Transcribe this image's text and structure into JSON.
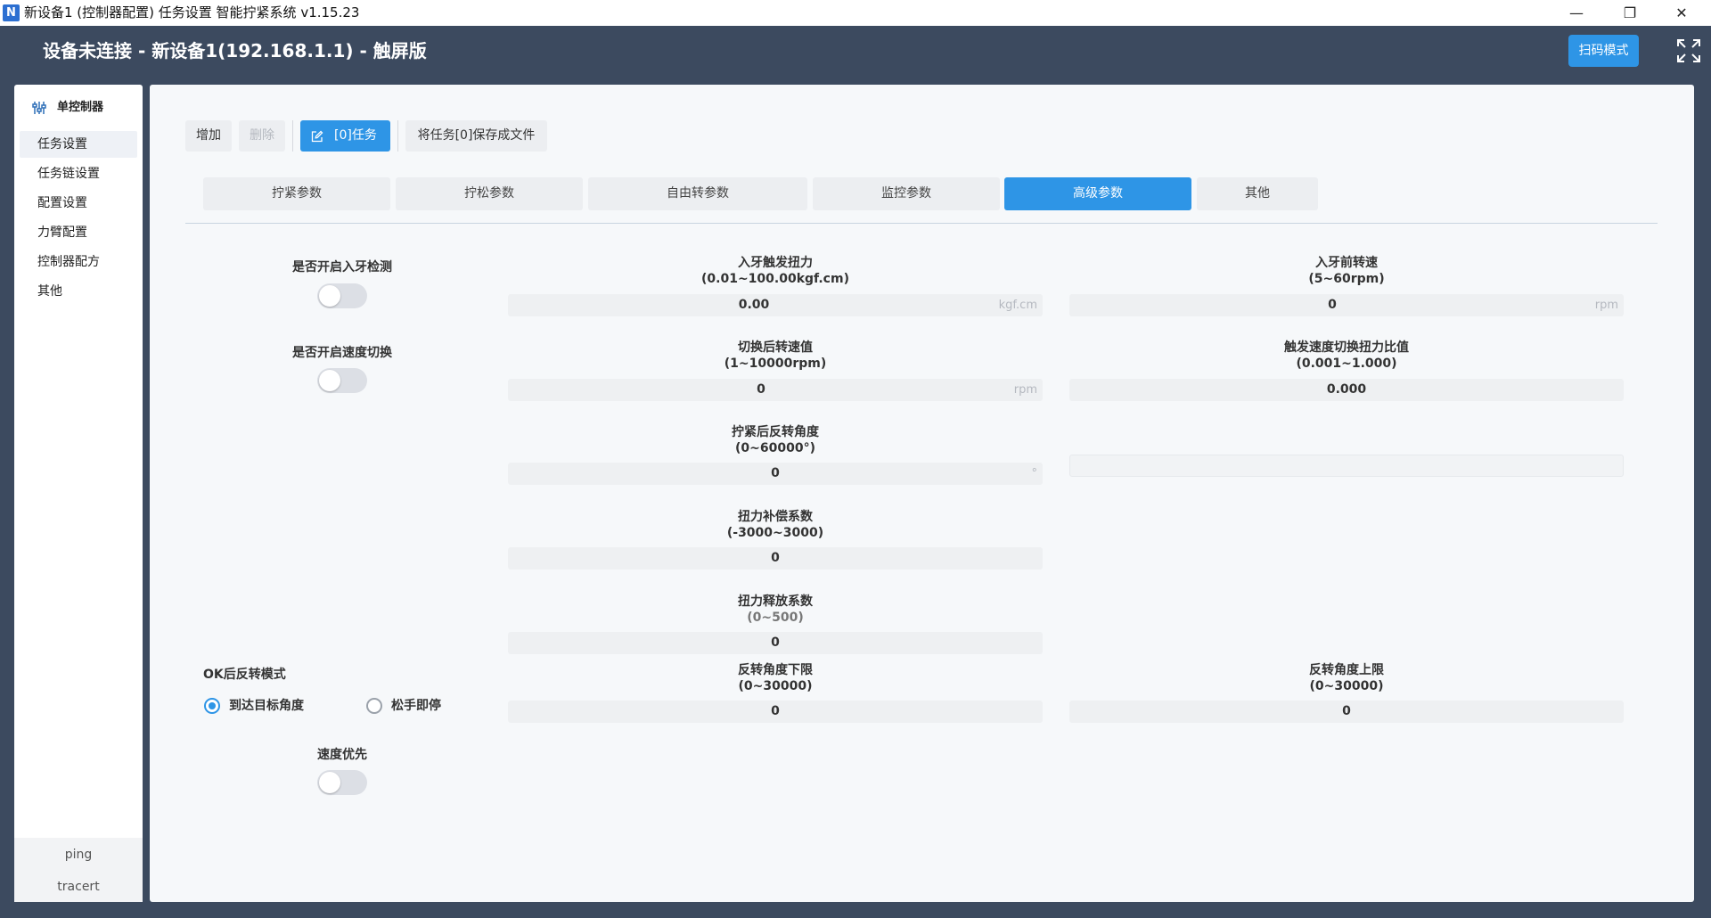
{
  "window": {
    "title": "新设备1 (控制器配置) 任务设置 智能拧紧系统 v1.15.23",
    "logo_glyph": "N",
    "minimize": "—",
    "maximize": "❐",
    "close": "✕"
  },
  "header": {
    "status_title": "设备未连接 - 新设备1(192.168.1.1) - 触屏版",
    "scan_mode": "扫码模式"
  },
  "sidebar": {
    "title": "单控制器",
    "items": [
      {
        "label": "任务设置"
      },
      {
        "label": "任务链设置"
      },
      {
        "label": "配置设置"
      },
      {
        "label": "力臂配置"
      },
      {
        "label": "控制器配方"
      },
      {
        "label": "其他"
      }
    ],
    "footer": [
      "ping",
      "tracert"
    ]
  },
  "toolbar": {
    "add": "增加",
    "delete": "删除",
    "task": "[0]任务",
    "save_file": "将任务[0]保存成文件"
  },
  "tabs": [
    "拧紧参数",
    "拧松参数",
    "自由转参数",
    "监控参数",
    "高级参数",
    "其他"
  ],
  "active_tab": "高级参数",
  "left_panel": {
    "thread_detect": "是否开启入牙检测",
    "speed_switch": "是否开启速度切换",
    "ok_reverse_mode": "OK后反转模式",
    "radio_target": "到达目标角度",
    "radio_release": "松手即停",
    "speed_priority": "速度优先"
  },
  "fields": {
    "thread_torque": {
      "label": "入牙触发扭力",
      "range": "(0.01~100.00kgf.cm)",
      "value": "0.00",
      "unit": "kgf.cm"
    },
    "pre_thread_speed": {
      "label": "入牙前转速",
      "range": "(5~60rpm)",
      "value": "0",
      "unit": "rpm"
    },
    "post_switch_speed": {
      "label": "切换后转速值",
      "range": "(1~10000rpm)",
      "value": "0",
      "unit": "rpm"
    },
    "switch_torque_ratio": {
      "label": "触发速度切换扭力比值",
      "range": "(0.001~1.000)",
      "value": "0.000"
    },
    "reverse_angle": {
      "label": "拧紧后反转角度",
      "range": "(0~60000°)",
      "value": "0",
      "unit": "°"
    },
    "torque_comp": {
      "label": "扭力补偿系数",
      "range": "(-3000~3000)",
      "value": "0"
    },
    "torque_release": {
      "label": "扭力释放系数",
      "range": "(0~500)",
      "value": "0"
    },
    "angle_lower": {
      "label": "反转角度下限",
      "range": "(0~30000)",
      "value": "0"
    },
    "angle_upper": {
      "label": "反转角度上限",
      "range": "(0~30000)",
      "value": "0"
    }
  },
  "colors": {
    "accent": "#2e95e6",
    "header": "#3c4a5f"
  }
}
